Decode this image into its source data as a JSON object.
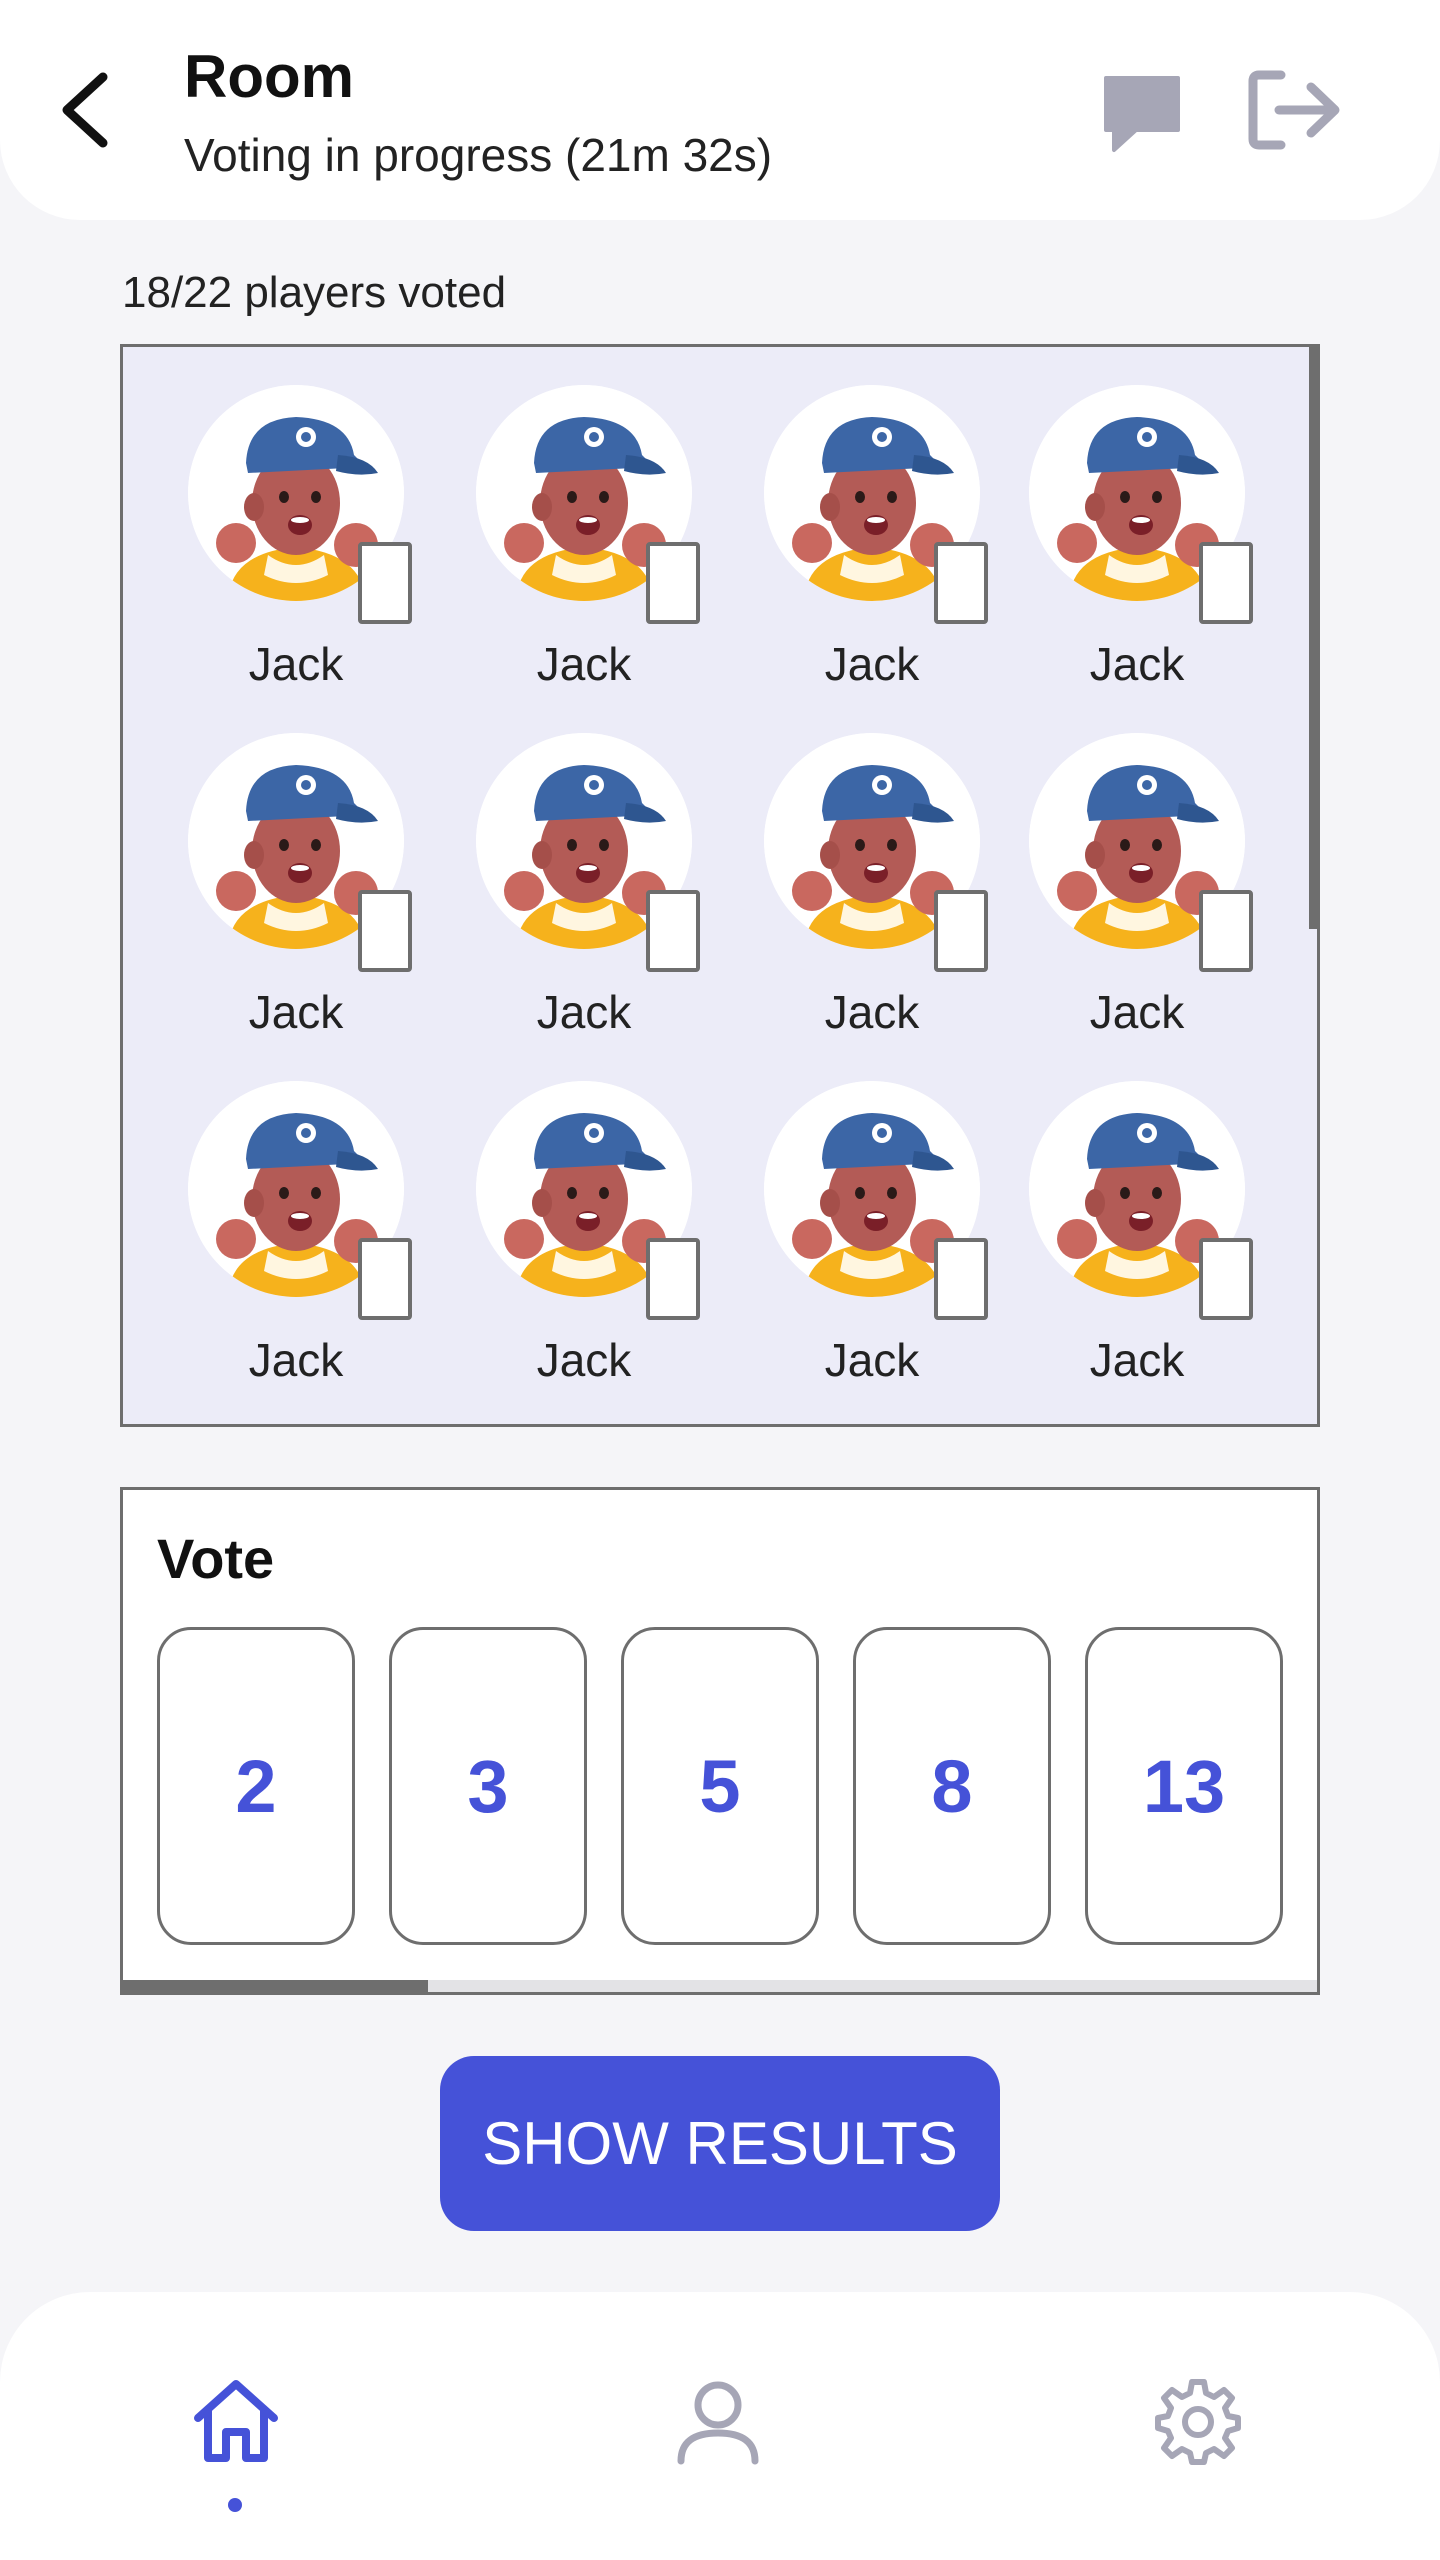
{
  "header": {
    "title": "Room",
    "subtitle": "Voting in progress (21m 32s)",
    "back_icon": "chevron-left-icon",
    "chat_icon": "chat-bubble-icon",
    "exit_icon": "logout-icon"
  },
  "players": {
    "voted_count": "18/22 players voted",
    "list": [
      {
        "name": "Jack"
      },
      {
        "name": "Jack"
      },
      {
        "name": "Jack"
      },
      {
        "name": "Jack"
      },
      {
        "name": "Jack"
      },
      {
        "name": "Jack"
      },
      {
        "name": "Jack"
      },
      {
        "name": "Jack"
      },
      {
        "name": "Jack"
      },
      {
        "name": "Jack"
      },
      {
        "name": "Jack"
      },
      {
        "name": "Jack"
      }
    ]
  },
  "vote": {
    "title": "Vote",
    "options": [
      "2",
      "3",
      "5",
      "8",
      "13"
    ]
  },
  "actions": {
    "show_results_label": "SHOW RESULTS"
  },
  "nav": {
    "items": [
      {
        "icon": "home-icon",
        "active": true
      },
      {
        "icon": "profile-icon",
        "active": false
      },
      {
        "icon": "settings-icon",
        "active": false
      }
    ]
  },
  "colors": {
    "accent": "#4552d8",
    "panel_bg": "#ececf8",
    "border": "#6e6e6e",
    "icon_muted": "#a6a6b6"
  }
}
